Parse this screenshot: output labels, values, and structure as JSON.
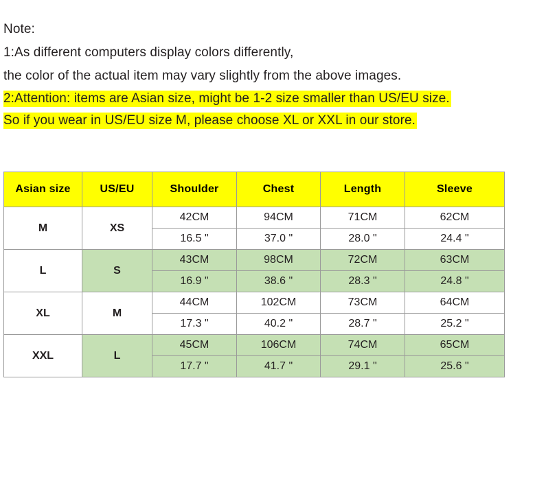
{
  "notes": {
    "lines": [
      {
        "text": "Note:",
        "highlighted": false
      },
      {
        "text": "1:As different computers display colors differently,",
        "highlighted": false
      },
      {
        "text": "the color of the actual item may vary slightly from the above images.",
        "highlighted": false
      },
      {
        "text": "2:Attention: items are Asian size, might be 1-2 size smaller than US/EU size.",
        "highlighted": true
      },
      {
        "text": "So if you wear in US/EU size M, please choose XL or XXL in our store.",
        "highlighted": true
      }
    ]
  },
  "colors": {
    "highlight_yellow": "#FFFF00",
    "header_yellow": "#FFFF00",
    "band_green": "#C5E0B4",
    "border_gray": "#9A9A9A",
    "text_dark": "#231F20"
  },
  "table": {
    "headers": [
      "Asian size",
      "US/EU",
      "Shoulder",
      "Chest",
      "Length",
      "Sleeve"
    ],
    "rows": [
      {
        "asian_size": "M",
        "us_eu": "XS",
        "banded": false,
        "cm": [
          "42CM",
          "94CM",
          "71CM",
          "62CM"
        ],
        "inch": [
          "16.5 \"",
          "37.0 \"",
          "28.0 \"",
          "24.4 \""
        ]
      },
      {
        "asian_size": "L",
        "us_eu": "S",
        "banded": true,
        "cm": [
          "43CM",
          "98CM",
          "72CM",
          "63CM"
        ],
        "inch": [
          "16.9 \"",
          "38.6 \"",
          "28.3 \"",
          "24.8 \""
        ]
      },
      {
        "asian_size": "XL",
        "us_eu": "M",
        "banded": false,
        "cm": [
          "44CM",
          "102CM",
          "73CM",
          "64CM"
        ],
        "inch": [
          "17.3 \"",
          "40.2 \"",
          "28.7 \"",
          "25.2 \""
        ]
      },
      {
        "asian_size": "XXL",
        "us_eu": "L",
        "banded": true,
        "cm": [
          "45CM",
          "106CM",
          "74CM",
          "65CM"
        ],
        "inch": [
          "17.7 \"",
          "41.7 \"",
          "29.1 \"",
          "25.6 \""
        ]
      }
    ]
  }
}
